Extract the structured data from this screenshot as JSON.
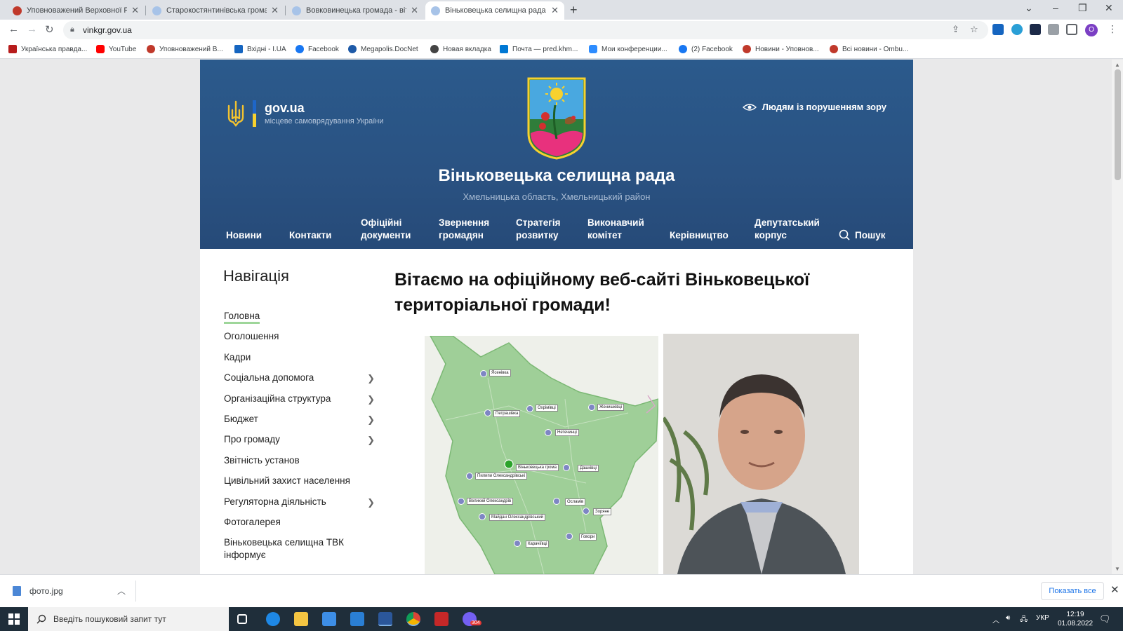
{
  "browser": {
    "tabs": [
      {
        "title": "Уповноважений Верховної Ради",
        "favicon_color": "#c0392b",
        "active": false
      },
      {
        "title": "Старокостянтинівська громада - с",
        "favicon_color": "#a7c3e8",
        "active": false
      },
      {
        "title": "Вовковинецька громада - вітає",
        "favicon_color": "#a7c3e8",
        "active": false
      },
      {
        "title": "Віньковецька селищна рада - в",
        "favicon_color": "#a7c3e8",
        "active": true
      }
    ],
    "new_tab": "+",
    "window_controls": {
      "dropdown": "⌄",
      "minimize": "–",
      "restore": "❐",
      "close": "✕"
    },
    "url": "vinkgr.gov.ua",
    "bookmarks": [
      {
        "label": "Українська правда...",
        "color": "#b71c1c"
      },
      {
        "label": "YouTube",
        "color": "#ff0000"
      },
      {
        "label": "Уповноважений В...",
        "color": "#c0392b"
      },
      {
        "label": "Вхідні - I.UA",
        "color": "#1565c0"
      },
      {
        "label": "Facebook",
        "color": "#1877f2"
      },
      {
        "label": "Megapolis.DocNet",
        "color": "#1e5aa8"
      },
      {
        "label": "Новая вкладка",
        "color": "#444444"
      },
      {
        "label": "Почта — pred.khm...",
        "color": "#0078d4"
      },
      {
        "label": "Мои конференции...",
        "color": "#2d8cff"
      },
      {
        "label": "(2) Facebook",
        "color": "#1877f2"
      },
      {
        "label": "Новини - Уповнов...",
        "color": "#c0392b"
      },
      {
        "label": "Всі новини - Ombu...",
        "color": "#c0392b"
      }
    ]
  },
  "header": {
    "gov_label": "gov.ua",
    "gov_sub": "місцеве самоврядування України",
    "vision_link": "Людям із порушенням зору",
    "title": "Віньковецька селищна рада",
    "subtitle": "Хмельницька область, Хмельницький район",
    "nav": [
      {
        "label": "Новини",
        "lines": [
          "Новини"
        ]
      },
      {
        "label": "Контакти",
        "lines": [
          "Контакти"
        ]
      },
      {
        "label": "Офіційні документи",
        "lines": [
          "Офіційні",
          "документи"
        ]
      },
      {
        "label": "Звернення громадян",
        "lines": [
          "Звернення",
          "громадян"
        ]
      },
      {
        "label": "Стратегія розвитку",
        "lines": [
          "Стратегія",
          "розвитку"
        ]
      },
      {
        "label": "Виконавчий комітет",
        "lines": [
          "Виконавчий",
          "комітет"
        ]
      },
      {
        "label": "Керівництво",
        "lines": [
          "Керівництво"
        ]
      },
      {
        "label": "Депутатський корпус",
        "lines": [
          "Депутатський",
          "корпус"
        ]
      }
    ],
    "search_label": "Пошук"
  },
  "sidebar": {
    "title": "Навігація",
    "items": [
      {
        "label": "Головна",
        "submenu": false,
        "active": true
      },
      {
        "label": "Оголошення",
        "submenu": false
      },
      {
        "label": "Кадри",
        "submenu": false
      },
      {
        "label": "Соціальна допомога",
        "submenu": true
      },
      {
        "label": "Організаційна структура",
        "submenu": true
      },
      {
        "label": "Бюджет",
        "submenu": true
      },
      {
        "label": "Про громаду",
        "submenu": true
      },
      {
        "label": "Звітність установ",
        "submenu": false
      },
      {
        "label": "Цивільний захист населення",
        "submenu": false
      },
      {
        "label": "Регуляторна діяльність",
        "submenu": true
      },
      {
        "label": "Фотогалерея",
        "submenu": false
      },
      {
        "label": "Віньковецька селищна ТВК інформує",
        "submenu": false
      }
    ]
  },
  "main": {
    "welcome_line1": "Вітаємо на офіційному веб-сайті Віньковецької",
    "welcome_line2": "територіальної громади!",
    "map_labels": [
      "Ясенівка",
      "Петрашівка",
      "Охрімівці",
      "Женишківці",
      "Нетечинці",
      "Віньковецька грома",
      "Дашківці",
      "Пилипи Олександрівські",
      "Великий Олександрів",
      "Осламів",
      "Зоряне",
      "Майдан Олександрівський",
      "Говори",
      "Карачіївці"
    ]
  },
  "downloads": {
    "file_name": "фото.jpg",
    "show_all": "Показать все"
  },
  "taskbar": {
    "search_placeholder": "Введіть пошуковий запит тут",
    "lang": "УКР",
    "time": "12:19",
    "date": "01.08.2022",
    "badge": "304"
  },
  "colors": {
    "header_blue": "#2a5282",
    "accent_green": "#9ed69a",
    "ua_blue": "#1e66c8",
    "ua_yellow": "#f7d12e"
  }
}
